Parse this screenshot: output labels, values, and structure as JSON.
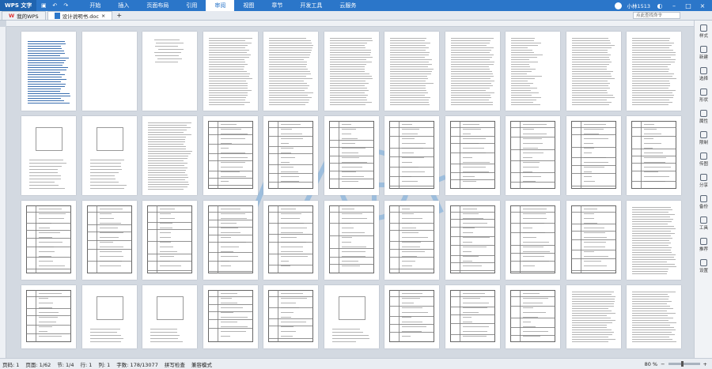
{
  "app": {
    "name": "WPS 文字",
    "menus": [
      "开始",
      "插入",
      "页面布局",
      "引用",
      "审阅",
      "视图",
      "章节",
      "开发工具",
      "云服务"
    ],
    "active_menu": "审阅",
    "user": "小林1513"
  },
  "tabs": [
    {
      "label": "我的WPS"
    },
    {
      "label": "设计说明书.doc"
    }
  ],
  "search_placeholder": "点此查找命令",
  "side_panel": [
    "样式",
    "新建",
    "选择",
    "形状",
    "属性",
    "限制",
    "传图",
    "分享",
    "备份",
    "工具",
    "推荐",
    "设置"
  ],
  "status": {
    "page_num": "页码: 1",
    "page": "页面: 1/62",
    "section": "节: 1/4",
    "line": "行: 1",
    "col": "列: 1",
    "words": "字数: 178/13077",
    "spell": "拼写检查",
    "protect": "兼容模式",
    "zoom": "80 %"
  },
  "colors": {
    "accent": "#2b76c9",
    "watermark": "#3a8ed8"
  },
  "watermark_text": "人人文库"
}
